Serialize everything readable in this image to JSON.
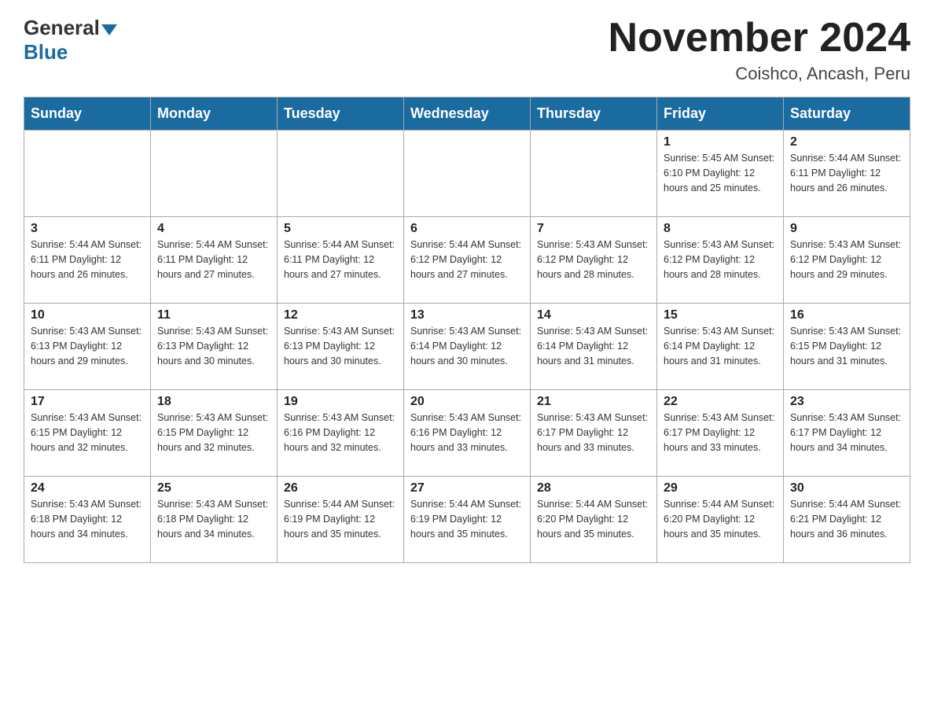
{
  "header": {
    "logo_general": "General",
    "logo_blue": "Blue",
    "month_title": "November 2024",
    "location": "Coishco, Ancash, Peru"
  },
  "days_of_week": [
    "Sunday",
    "Monday",
    "Tuesday",
    "Wednesday",
    "Thursday",
    "Friday",
    "Saturday"
  ],
  "weeks": [
    [
      {
        "day": "",
        "info": ""
      },
      {
        "day": "",
        "info": ""
      },
      {
        "day": "",
        "info": ""
      },
      {
        "day": "",
        "info": ""
      },
      {
        "day": "",
        "info": ""
      },
      {
        "day": "1",
        "info": "Sunrise: 5:45 AM\nSunset: 6:10 PM\nDaylight: 12 hours and 25 minutes."
      },
      {
        "day": "2",
        "info": "Sunrise: 5:44 AM\nSunset: 6:11 PM\nDaylight: 12 hours and 26 minutes."
      }
    ],
    [
      {
        "day": "3",
        "info": "Sunrise: 5:44 AM\nSunset: 6:11 PM\nDaylight: 12 hours and 26 minutes."
      },
      {
        "day": "4",
        "info": "Sunrise: 5:44 AM\nSunset: 6:11 PM\nDaylight: 12 hours and 27 minutes."
      },
      {
        "day": "5",
        "info": "Sunrise: 5:44 AM\nSunset: 6:11 PM\nDaylight: 12 hours and 27 minutes."
      },
      {
        "day": "6",
        "info": "Sunrise: 5:44 AM\nSunset: 6:12 PM\nDaylight: 12 hours and 27 minutes."
      },
      {
        "day": "7",
        "info": "Sunrise: 5:43 AM\nSunset: 6:12 PM\nDaylight: 12 hours and 28 minutes."
      },
      {
        "day": "8",
        "info": "Sunrise: 5:43 AM\nSunset: 6:12 PM\nDaylight: 12 hours and 28 minutes."
      },
      {
        "day": "9",
        "info": "Sunrise: 5:43 AM\nSunset: 6:12 PM\nDaylight: 12 hours and 29 minutes."
      }
    ],
    [
      {
        "day": "10",
        "info": "Sunrise: 5:43 AM\nSunset: 6:13 PM\nDaylight: 12 hours and 29 minutes."
      },
      {
        "day": "11",
        "info": "Sunrise: 5:43 AM\nSunset: 6:13 PM\nDaylight: 12 hours and 30 minutes."
      },
      {
        "day": "12",
        "info": "Sunrise: 5:43 AM\nSunset: 6:13 PM\nDaylight: 12 hours and 30 minutes."
      },
      {
        "day": "13",
        "info": "Sunrise: 5:43 AM\nSunset: 6:14 PM\nDaylight: 12 hours and 30 minutes."
      },
      {
        "day": "14",
        "info": "Sunrise: 5:43 AM\nSunset: 6:14 PM\nDaylight: 12 hours and 31 minutes."
      },
      {
        "day": "15",
        "info": "Sunrise: 5:43 AM\nSunset: 6:14 PM\nDaylight: 12 hours and 31 minutes."
      },
      {
        "day": "16",
        "info": "Sunrise: 5:43 AM\nSunset: 6:15 PM\nDaylight: 12 hours and 31 minutes."
      }
    ],
    [
      {
        "day": "17",
        "info": "Sunrise: 5:43 AM\nSunset: 6:15 PM\nDaylight: 12 hours and 32 minutes."
      },
      {
        "day": "18",
        "info": "Sunrise: 5:43 AM\nSunset: 6:15 PM\nDaylight: 12 hours and 32 minutes."
      },
      {
        "day": "19",
        "info": "Sunrise: 5:43 AM\nSunset: 6:16 PM\nDaylight: 12 hours and 32 minutes."
      },
      {
        "day": "20",
        "info": "Sunrise: 5:43 AM\nSunset: 6:16 PM\nDaylight: 12 hours and 33 minutes."
      },
      {
        "day": "21",
        "info": "Sunrise: 5:43 AM\nSunset: 6:17 PM\nDaylight: 12 hours and 33 minutes."
      },
      {
        "day": "22",
        "info": "Sunrise: 5:43 AM\nSunset: 6:17 PM\nDaylight: 12 hours and 33 minutes."
      },
      {
        "day": "23",
        "info": "Sunrise: 5:43 AM\nSunset: 6:17 PM\nDaylight: 12 hours and 34 minutes."
      }
    ],
    [
      {
        "day": "24",
        "info": "Sunrise: 5:43 AM\nSunset: 6:18 PM\nDaylight: 12 hours and 34 minutes."
      },
      {
        "day": "25",
        "info": "Sunrise: 5:43 AM\nSunset: 6:18 PM\nDaylight: 12 hours and 34 minutes."
      },
      {
        "day": "26",
        "info": "Sunrise: 5:44 AM\nSunset: 6:19 PM\nDaylight: 12 hours and 35 minutes."
      },
      {
        "day": "27",
        "info": "Sunrise: 5:44 AM\nSunset: 6:19 PM\nDaylight: 12 hours and 35 minutes."
      },
      {
        "day": "28",
        "info": "Sunrise: 5:44 AM\nSunset: 6:20 PM\nDaylight: 12 hours and 35 minutes."
      },
      {
        "day": "29",
        "info": "Sunrise: 5:44 AM\nSunset: 6:20 PM\nDaylight: 12 hours and 35 minutes."
      },
      {
        "day": "30",
        "info": "Sunrise: 5:44 AM\nSunset: 6:21 PM\nDaylight: 12 hours and 36 minutes."
      }
    ]
  ]
}
